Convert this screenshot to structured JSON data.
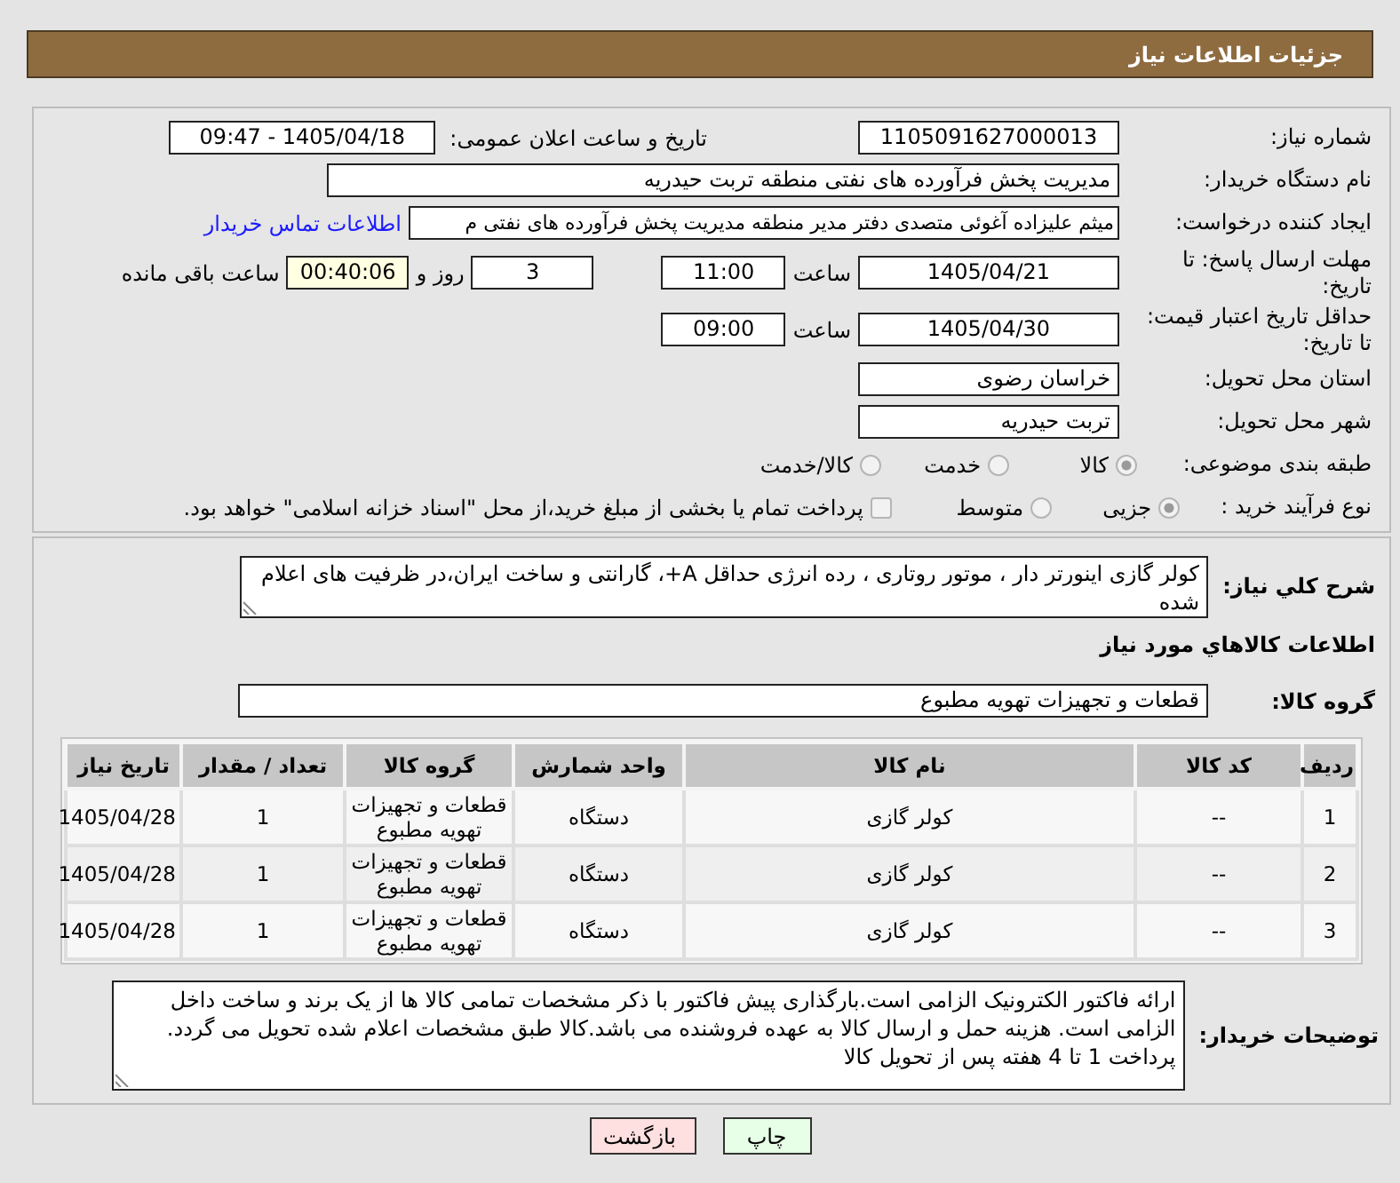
{
  "header": {
    "title": "جزئیات اطلاعات نیاز"
  },
  "details": {
    "need_number": {
      "label": "شماره نیاز:",
      "value": "1105091627000013"
    },
    "announce_datetime": {
      "label": "تاریخ و ساعت اعلان عمومی:",
      "value": "1405/04/18 - 09:47"
    },
    "buyer_org": {
      "label": "نام دستگاه خریدار:",
      "value": "مدیریت پخش فرآورده های نفتی منطقه تربت حیدریه"
    },
    "requester": {
      "label": "ایجاد کننده درخواست:",
      "value": "میثم علیزاده آغوئی متصدی دفتر مدیر منطقه مدیریت پخش فرآورده های نفتی م",
      "link": "اطلاعات تماس خریدار"
    },
    "response_deadline": {
      "label": "مهلت ارسال پاسخ: تا تاریخ:",
      "date": "1405/04/21",
      "time_label": "ساعت",
      "time": "11:00",
      "days": "3",
      "days_label": "روز و",
      "remaining": "00:40:06",
      "remaining_label": "ساعت باقی مانده"
    },
    "price_validity": {
      "label": "حداقل تاریخ اعتبار قیمت: تا تاریخ:",
      "date": "1405/04/30",
      "time_label": "ساعت",
      "time": "09:00"
    },
    "province": {
      "label": "استان محل تحویل:",
      "value": "خراسان رضوی"
    },
    "city": {
      "label": "شهر محل تحویل:",
      "value": "تربت حیدریه"
    },
    "category": {
      "label": "طبقه بندی موضوعی:",
      "options": [
        {
          "label": "کالا",
          "selected": true
        },
        {
          "label": "خدمت",
          "selected": false
        },
        {
          "label": "کالا/خدمت",
          "selected": false
        }
      ]
    },
    "purchase_type": {
      "label": "نوع فرآیند خرید :",
      "options": [
        {
          "label": "جزیی",
          "selected": true
        },
        {
          "label": "متوسط",
          "selected": false
        }
      ],
      "payment_option": {
        "label": "پرداخت تمام یا بخشی از مبلغ خرید،از محل \"اسناد خزانه اسلامی\" خواهد بود.",
        "checked": false
      }
    }
  },
  "summary": {
    "label": "شرح کلي نياز:",
    "value": "کولر گازی اینورتر دار ، موتور روتاری ، رده انرژی حداقل  A+، گارانتی و ساخت ایران،در ظرفیت های اعلام شده"
  },
  "goods": {
    "title": "اطلاعات کالاهاي مورد نياز",
    "group_label": "گروه کالا:",
    "group_value": "قطعات و تجهیزات تهویه مطبوع",
    "table": {
      "columns": [
        "ردیف",
        "کد کالا",
        "نام کالا",
        "واحد شمارش",
        "گروه کالا",
        "تعداد / مقدار",
        "تاریخ نیاز"
      ],
      "rows": [
        [
          "1",
          "--",
          "کولر گازی",
          "دستگاه",
          "قطعات و تجهیزات تهویه مطبوع",
          "1",
          "1405/04/28"
        ],
        [
          "2",
          "--",
          "کولر گازی",
          "دستگاه",
          "قطعات و تجهیزات تهویه مطبوع",
          "1",
          "1405/04/28"
        ],
        [
          "3",
          "--",
          "کولر گازی",
          "دستگاه",
          "قطعات و تجهیزات تهویه مطبوع",
          "1",
          "1405/04/28"
        ]
      ]
    }
  },
  "buyer_notes": {
    "label": "توضیحات خریدار:",
    "value": "ارائه فاکتور الکترونیک الزامی است.بارگذاری پیش فاکتور با ذکر مشخصات تمامی کالا ها از یک برند و ساخت داخل الزامی است. هزینه حمل و ارسال کالا به عهده فروشنده می باشد.کالا طبق مشخصات اعلام شده تحویل می گردد. پرداخت 1 تا 4 هفته پس از تحویل کالا"
  },
  "buttons": [
    {
      "label": "چاپ",
      "kind": "print"
    },
    {
      "label": "بازگشت",
      "kind": "back"
    }
  ]
}
